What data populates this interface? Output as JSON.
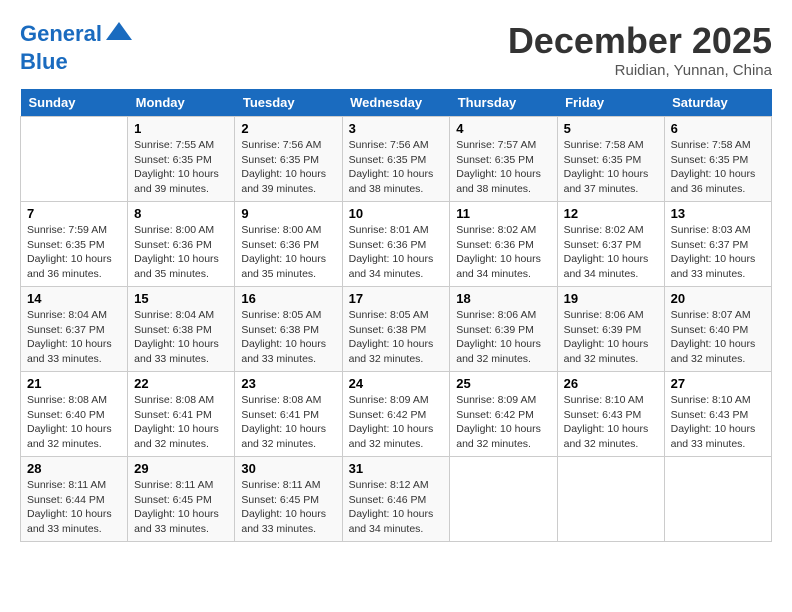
{
  "header": {
    "logo_line1": "General",
    "logo_line2": "Blue",
    "month": "December 2025",
    "location": "Ruidian, Yunnan, China"
  },
  "weekdays": [
    "Sunday",
    "Monday",
    "Tuesday",
    "Wednesday",
    "Thursday",
    "Friday",
    "Saturday"
  ],
  "weeks": [
    [
      {
        "num": "",
        "sunrise": "",
        "sunset": "",
        "daylight": ""
      },
      {
        "num": "1",
        "sunrise": "Sunrise: 7:55 AM",
        "sunset": "Sunset: 6:35 PM",
        "daylight": "Daylight: 10 hours and 39 minutes."
      },
      {
        "num": "2",
        "sunrise": "Sunrise: 7:56 AM",
        "sunset": "Sunset: 6:35 PM",
        "daylight": "Daylight: 10 hours and 39 minutes."
      },
      {
        "num": "3",
        "sunrise": "Sunrise: 7:56 AM",
        "sunset": "Sunset: 6:35 PM",
        "daylight": "Daylight: 10 hours and 38 minutes."
      },
      {
        "num": "4",
        "sunrise": "Sunrise: 7:57 AM",
        "sunset": "Sunset: 6:35 PM",
        "daylight": "Daylight: 10 hours and 38 minutes."
      },
      {
        "num": "5",
        "sunrise": "Sunrise: 7:58 AM",
        "sunset": "Sunset: 6:35 PM",
        "daylight": "Daylight: 10 hours and 37 minutes."
      },
      {
        "num": "6",
        "sunrise": "Sunrise: 7:58 AM",
        "sunset": "Sunset: 6:35 PM",
        "daylight": "Daylight: 10 hours and 36 minutes."
      }
    ],
    [
      {
        "num": "7",
        "sunrise": "Sunrise: 7:59 AM",
        "sunset": "Sunset: 6:35 PM",
        "daylight": "Daylight: 10 hours and 36 minutes."
      },
      {
        "num": "8",
        "sunrise": "Sunrise: 8:00 AM",
        "sunset": "Sunset: 6:36 PM",
        "daylight": "Daylight: 10 hours and 35 minutes."
      },
      {
        "num": "9",
        "sunrise": "Sunrise: 8:00 AM",
        "sunset": "Sunset: 6:36 PM",
        "daylight": "Daylight: 10 hours and 35 minutes."
      },
      {
        "num": "10",
        "sunrise": "Sunrise: 8:01 AM",
        "sunset": "Sunset: 6:36 PM",
        "daylight": "Daylight: 10 hours and 34 minutes."
      },
      {
        "num": "11",
        "sunrise": "Sunrise: 8:02 AM",
        "sunset": "Sunset: 6:36 PM",
        "daylight": "Daylight: 10 hours and 34 minutes."
      },
      {
        "num": "12",
        "sunrise": "Sunrise: 8:02 AM",
        "sunset": "Sunset: 6:37 PM",
        "daylight": "Daylight: 10 hours and 34 minutes."
      },
      {
        "num": "13",
        "sunrise": "Sunrise: 8:03 AM",
        "sunset": "Sunset: 6:37 PM",
        "daylight": "Daylight: 10 hours and 33 minutes."
      }
    ],
    [
      {
        "num": "14",
        "sunrise": "Sunrise: 8:04 AM",
        "sunset": "Sunset: 6:37 PM",
        "daylight": "Daylight: 10 hours and 33 minutes."
      },
      {
        "num": "15",
        "sunrise": "Sunrise: 8:04 AM",
        "sunset": "Sunset: 6:38 PM",
        "daylight": "Daylight: 10 hours and 33 minutes."
      },
      {
        "num": "16",
        "sunrise": "Sunrise: 8:05 AM",
        "sunset": "Sunset: 6:38 PM",
        "daylight": "Daylight: 10 hours and 33 minutes."
      },
      {
        "num": "17",
        "sunrise": "Sunrise: 8:05 AM",
        "sunset": "Sunset: 6:38 PM",
        "daylight": "Daylight: 10 hours and 32 minutes."
      },
      {
        "num": "18",
        "sunrise": "Sunrise: 8:06 AM",
        "sunset": "Sunset: 6:39 PM",
        "daylight": "Daylight: 10 hours and 32 minutes."
      },
      {
        "num": "19",
        "sunrise": "Sunrise: 8:06 AM",
        "sunset": "Sunset: 6:39 PM",
        "daylight": "Daylight: 10 hours and 32 minutes."
      },
      {
        "num": "20",
        "sunrise": "Sunrise: 8:07 AM",
        "sunset": "Sunset: 6:40 PM",
        "daylight": "Daylight: 10 hours and 32 minutes."
      }
    ],
    [
      {
        "num": "21",
        "sunrise": "Sunrise: 8:08 AM",
        "sunset": "Sunset: 6:40 PM",
        "daylight": "Daylight: 10 hours and 32 minutes."
      },
      {
        "num": "22",
        "sunrise": "Sunrise: 8:08 AM",
        "sunset": "Sunset: 6:41 PM",
        "daylight": "Daylight: 10 hours and 32 minutes."
      },
      {
        "num": "23",
        "sunrise": "Sunrise: 8:08 AM",
        "sunset": "Sunset: 6:41 PM",
        "daylight": "Daylight: 10 hours and 32 minutes."
      },
      {
        "num": "24",
        "sunrise": "Sunrise: 8:09 AM",
        "sunset": "Sunset: 6:42 PM",
        "daylight": "Daylight: 10 hours and 32 minutes."
      },
      {
        "num": "25",
        "sunrise": "Sunrise: 8:09 AM",
        "sunset": "Sunset: 6:42 PM",
        "daylight": "Daylight: 10 hours and 32 minutes."
      },
      {
        "num": "26",
        "sunrise": "Sunrise: 8:10 AM",
        "sunset": "Sunset: 6:43 PM",
        "daylight": "Daylight: 10 hours and 32 minutes."
      },
      {
        "num": "27",
        "sunrise": "Sunrise: 8:10 AM",
        "sunset": "Sunset: 6:43 PM",
        "daylight": "Daylight: 10 hours and 33 minutes."
      }
    ],
    [
      {
        "num": "28",
        "sunrise": "Sunrise: 8:11 AM",
        "sunset": "Sunset: 6:44 PM",
        "daylight": "Daylight: 10 hours and 33 minutes."
      },
      {
        "num": "29",
        "sunrise": "Sunrise: 8:11 AM",
        "sunset": "Sunset: 6:45 PM",
        "daylight": "Daylight: 10 hours and 33 minutes."
      },
      {
        "num": "30",
        "sunrise": "Sunrise: 8:11 AM",
        "sunset": "Sunset: 6:45 PM",
        "daylight": "Daylight: 10 hours and 33 minutes."
      },
      {
        "num": "31",
        "sunrise": "Sunrise: 8:12 AM",
        "sunset": "Sunset: 6:46 PM",
        "daylight": "Daylight: 10 hours and 34 minutes."
      },
      {
        "num": "",
        "sunrise": "",
        "sunset": "",
        "daylight": ""
      },
      {
        "num": "",
        "sunrise": "",
        "sunset": "",
        "daylight": ""
      },
      {
        "num": "",
        "sunrise": "",
        "sunset": "",
        "daylight": ""
      }
    ]
  ]
}
